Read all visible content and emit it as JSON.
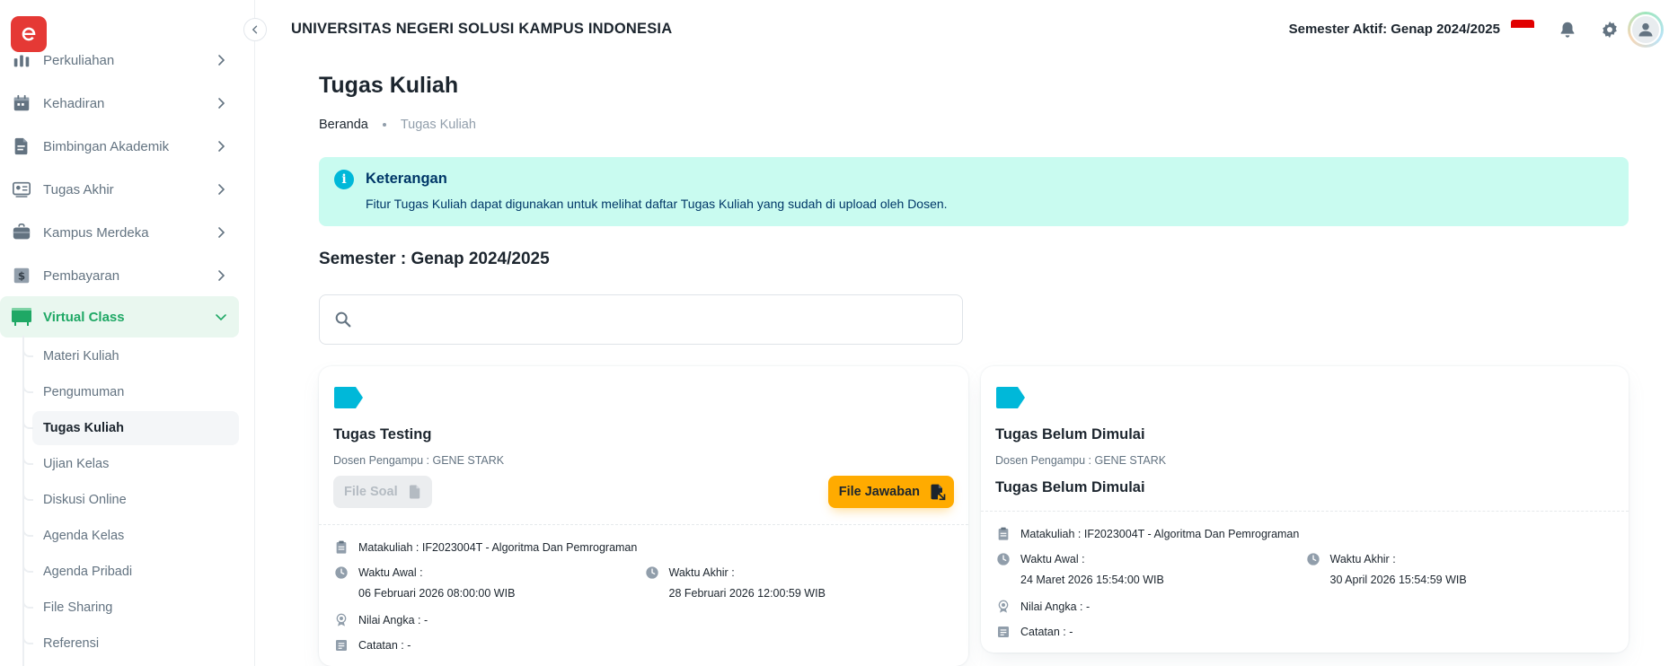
{
  "header": {
    "title": "UNIVERSITAS NEGERI SOLUSI KAMPUS INDONESIA",
    "semester_active": "Semester Aktif: Genap 2024/2025"
  },
  "sidebar": {
    "items": [
      {
        "label": "Perkuliahan",
        "icon": "chart-icon"
      },
      {
        "label": "Kehadiran",
        "icon": "calendar-icon"
      },
      {
        "label": "Bimbingan Akademik",
        "icon": "document-icon"
      },
      {
        "label": "Tugas Akhir",
        "icon": "id-card-icon"
      },
      {
        "label": "Kampus Merdeka",
        "icon": "briefcase-icon"
      },
      {
        "label": "Pembayaran",
        "icon": "dollar-icon"
      },
      {
        "label": "Virtual Class",
        "icon": "board-icon"
      }
    ],
    "sub_items": [
      {
        "label": "Materi Kuliah"
      },
      {
        "label": "Pengumuman"
      },
      {
        "label": "Tugas Kuliah"
      },
      {
        "label": "Ujian Kelas"
      },
      {
        "label": "Diskusi Online"
      },
      {
        "label": "Agenda Kelas"
      },
      {
        "label": "Agenda Pribadi"
      },
      {
        "label": "File Sharing"
      },
      {
        "label": "Referensi"
      }
    ]
  },
  "page": {
    "title": "Tugas Kuliah",
    "breadcrumb": {
      "home": "Beranda",
      "current": "Tugas Kuliah"
    },
    "alert": {
      "title": "Keterangan",
      "text": "Fitur Tugas Kuliah dapat digunakan untuk melihat daftar Tugas Kuliah yang sudah di upload oleh Dosen."
    },
    "semester_heading": "Semester : Genap 2024/2025",
    "search": {
      "placeholder": "",
      "value": ""
    }
  },
  "cards": [
    {
      "title": "Tugas Testing",
      "lecturer": "Dosen Pengampu : GENE STARK",
      "file_soal_label": "File Soal",
      "file_jawaban_label": "File Jawaban",
      "matakuliah": "Matakuliah : IF2023004T - Algoritma Dan Pemrograman",
      "waktu_awal_label": "Waktu Awal :",
      "waktu_awal": "06 Februari 2026 08:00:00 WIB",
      "waktu_akhir_label": "Waktu Akhir :",
      "waktu_akhir": "28 Februari 2026 12:00:59 WIB",
      "nilai": "Nilai Angka : -",
      "catatan": "Catatan : -"
    },
    {
      "title": "Tugas Belum Dimulai",
      "lecturer": "Dosen Pengampu : GENE STARK",
      "status": "Tugas Belum Dimulai",
      "matakuliah": "Matakuliah : IF2023004T - Algoritma Dan Pemrograman",
      "waktu_awal_label": "Waktu Awal :",
      "waktu_awal": "24 Maret 2026 15:54:00 WIB",
      "waktu_akhir_label": "Waktu Akhir :",
      "waktu_akhir": "30 April 2026 15:54:59 WIB",
      "nilai": "Nilai Angka : -",
      "catatan": "Catatan : -"
    }
  ],
  "colors": {
    "brand": "#e53935",
    "active_green": "#1fa865",
    "accent_cyan": "#00b8d9",
    "warning": "#ffab00",
    "alert_bg": "#c9fbf0"
  }
}
